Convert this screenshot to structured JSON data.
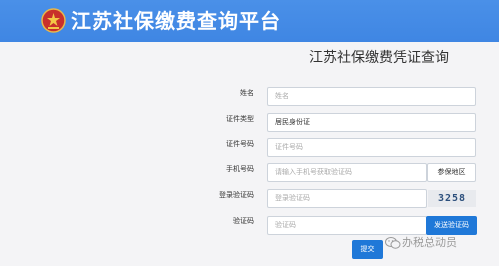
{
  "header": {
    "title": "江苏社保缴费查询平台",
    "emblem_icon": "tax-emblem-icon"
  },
  "main": {
    "title": "江苏社保缴费凭证查询"
  },
  "form": {
    "name": {
      "label": "姓名",
      "placeholder": "姓名"
    },
    "id_type": {
      "label": "证件类型",
      "value": "居民身份证"
    },
    "id_number": {
      "label": "证件号码",
      "placeholder": "证件号码"
    },
    "phone": {
      "label": "手机号码",
      "placeholder": "请输入手机号获取验证码",
      "region_button": "参保地区"
    },
    "login_captcha": {
      "label": "登录验证码",
      "placeholder": "登录验证码",
      "captcha_value": "3258"
    },
    "sms_code": {
      "label": "验证码",
      "placeholder": "验证码",
      "send_button": "发送验证码"
    },
    "submit_label": "提交"
  },
  "watermark": {
    "text": "办税总动员",
    "icon": "wechat-icon"
  },
  "colors": {
    "header_bg": "#4a90e8",
    "button_bg": "#1f78d8",
    "page_bg": "#f4f4f6"
  }
}
